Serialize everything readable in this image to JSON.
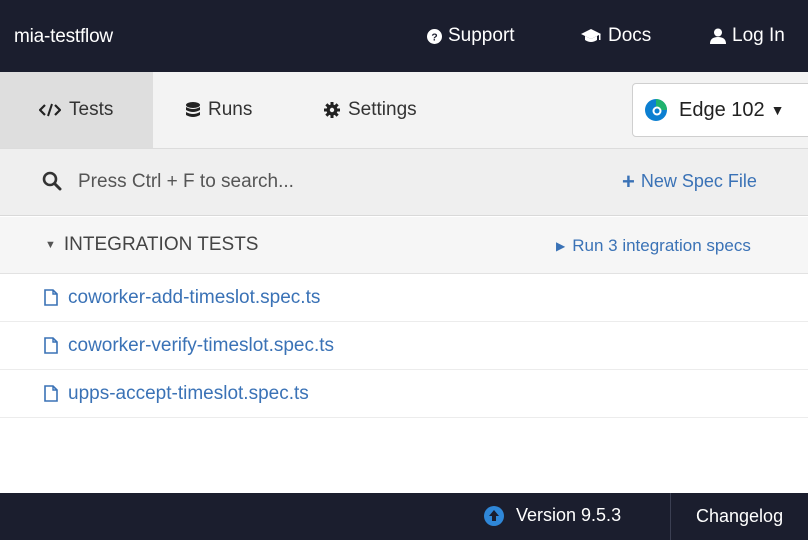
{
  "header": {
    "project_name": "mia-testflow",
    "support_label": "Support",
    "docs_label": "Docs",
    "login_label": "Log In"
  },
  "tabs": [
    {
      "label": "Tests",
      "icon": "code-icon",
      "active": true
    },
    {
      "label": "Runs",
      "icon": "database-icon",
      "active": false
    },
    {
      "label": "Settings",
      "icon": "gear-icon",
      "active": false
    }
  ],
  "browser": {
    "label": "Edge 102",
    "icon": "edge-icon"
  },
  "search": {
    "placeholder": "Press Ctrl + F to search..."
  },
  "new_spec_label": "New Spec File",
  "section": {
    "title": "INTEGRATION TESTS",
    "run_all_label": "Run 3 integration specs"
  },
  "specs": [
    "coworker-add-timeslot.spec.ts",
    "coworker-verify-timeslot.spec.ts",
    "upps-accept-timeslot.spec.ts"
  ],
  "footer": {
    "version_label": "Version 9.5.3",
    "changelog_label": "Changelog"
  },
  "colors": {
    "header_bg": "#1b1e2e",
    "link": "#3a72b6",
    "active_tab": "#dedede",
    "update_icon": "#2f87d8"
  }
}
